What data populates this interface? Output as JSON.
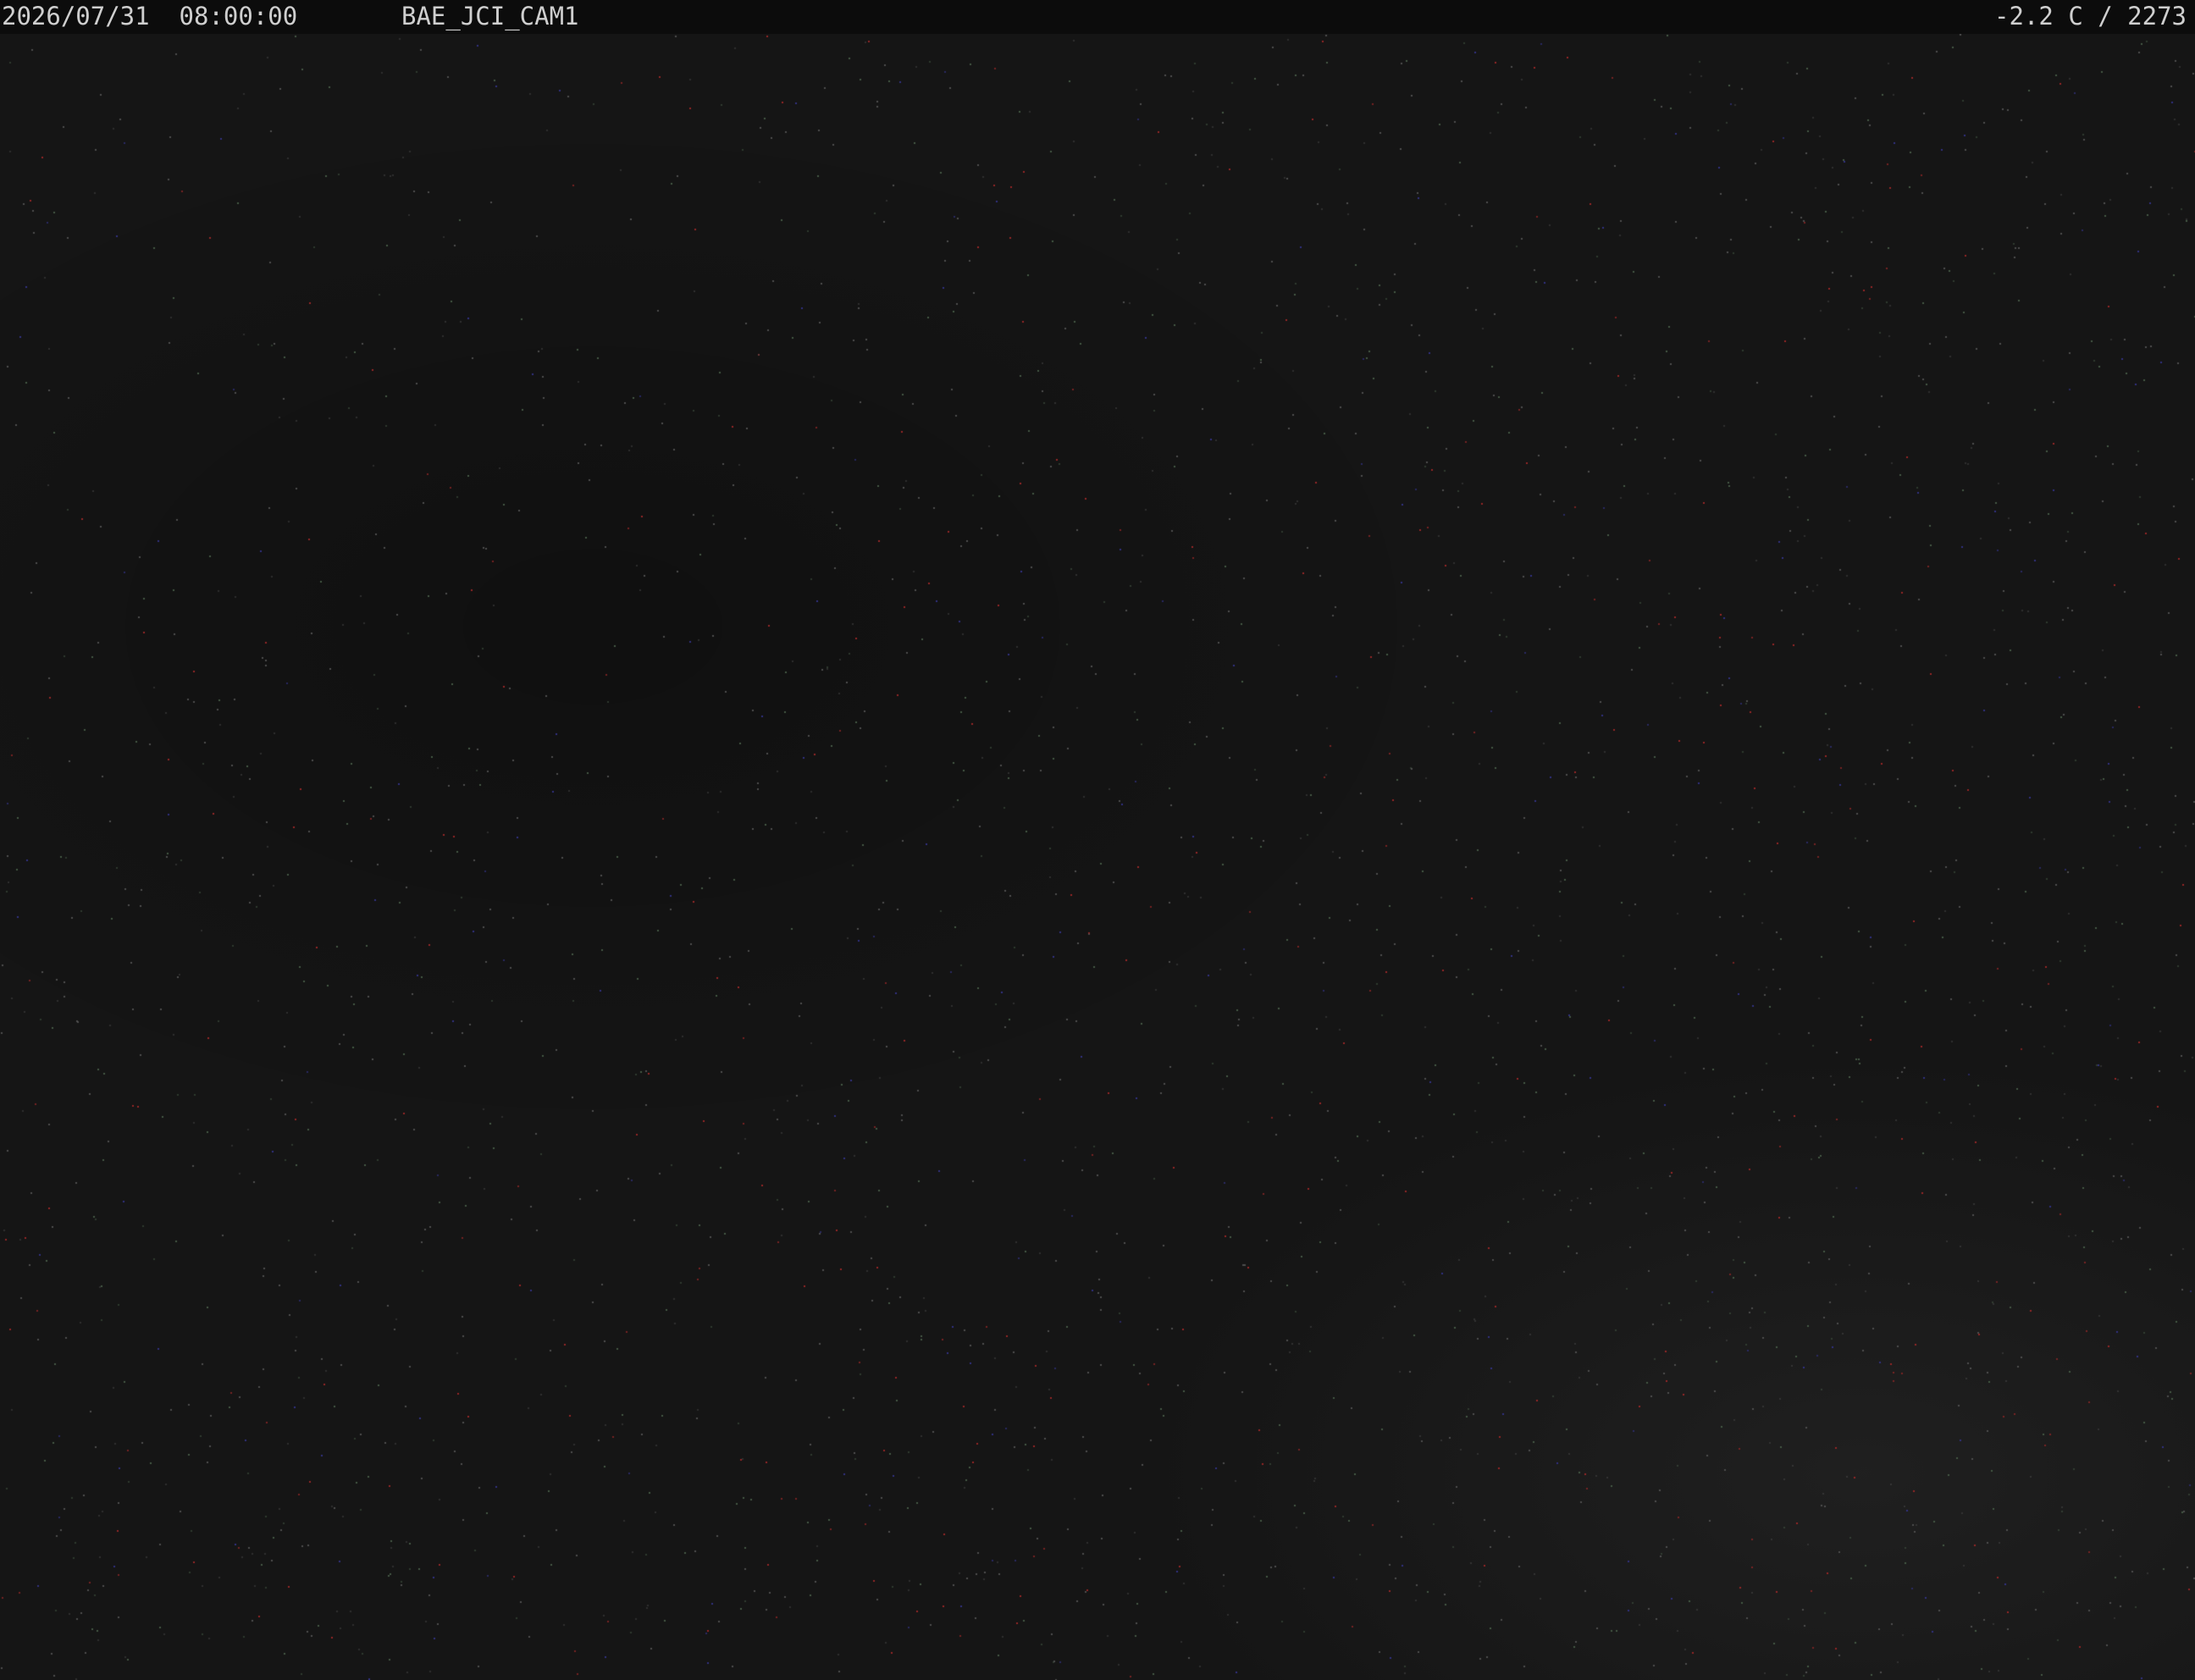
{
  "overlay": {
    "timestamp": "2026/07/31  08:00:00",
    "camera_id": "BAE_JCI_CAM1",
    "readout": "-2.2 C / 2273"
  },
  "colors": {
    "overlay_background": "#0c0c0c",
    "overlay_text": "#cfcfcf",
    "scene_background": "#151515"
  }
}
